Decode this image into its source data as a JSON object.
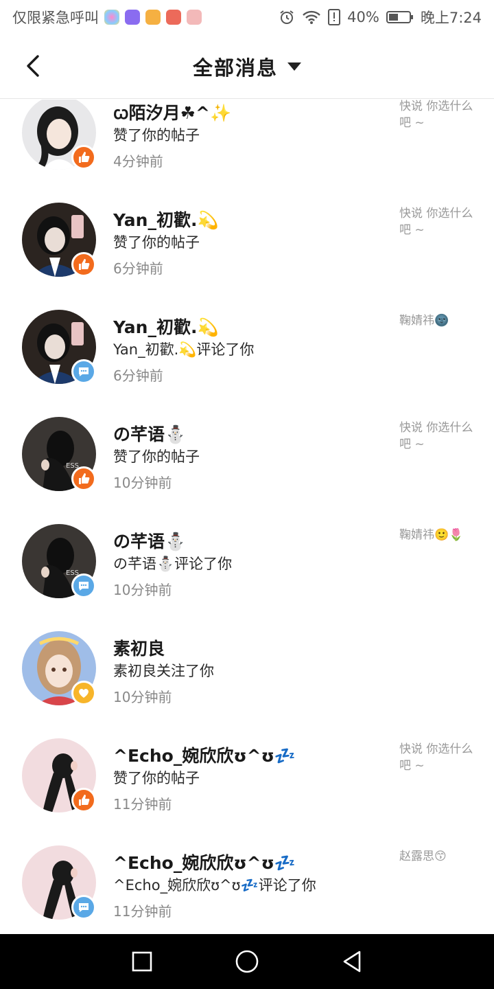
{
  "status_bar": {
    "carrier_text": "仅限紧急呼叫",
    "battery": "40%",
    "time": "晚上7:24",
    "app_icons": [
      "multicolor-app-icon",
      "purple-app-icon",
      "orange-play-app-icon",
      "red-app-icon",
      "pink-gift-app-icon"
    ]
  },
  "header": {
    "title": "全部消息"
  },
  "messages": [
    {
      "name": "ꞷ陌汐月☘︎^✨",
      "action": "赞了你的帖子",
      "time": "4分钟前",
      "preview": "快说 你选什么吧 ~",
      "type": "like"
    },
    {
      "name": "Yan_初歡.💫",
      "action": "赞了你的帖子",
      "time": "6分钟前",
      "preview": "快说 你选什么吧 ~",
      "type": "like"
    },
    {
      "name": "Yan_初歡.💫",
      "action": "Yan_初歡.💫评论了你",
      "time": "6分钟前",
      "preview": "鞠婧祎🌚",
      "type": "comment"
    },
    {
      "name": "の芊语⛄",
      "action": "赞了你的帖子",
      "time": "10分钟前",
      "preview": "快说 你选什么吧 ~",
      "type": "like"
    },
    {
      "name": "の芊语⛄",
      "action": "の芊语⛄评论了你",
      "time": "10分钟前",
      "preview": "鞠婧祎🙂🌷",
      "type": "comment"
    },
    {
      "name": "素初良",
      "action": "素初良关注了你",
      "time": "10分钟前",
      "preview": "",
      "type": "follow"
    },
    {
      "name": "^Echo_婉欣欣ʊ^ʊ💤",
      "action": "赞了你的帖子",
      "time": "11分钟前",
      "preview": "快说 你选什么吧 ~",
      "type": "like"
    },
    {
      "name": "^Echo_婉欣欣ʊ^ʊ💤",
      "action": "^Echo_婉欣欣ʊ^ʊ💤评论了你",
      "time": "11分钟前",
      "preview": "赵露思😙",
      "type": "comment"
    }
  ],
  "colors": {
    "like_badge": "#f26b1d",
    "comment_badge": "#5aa8e6",
    "follow_badge": "#f7b52a"
  }
}
